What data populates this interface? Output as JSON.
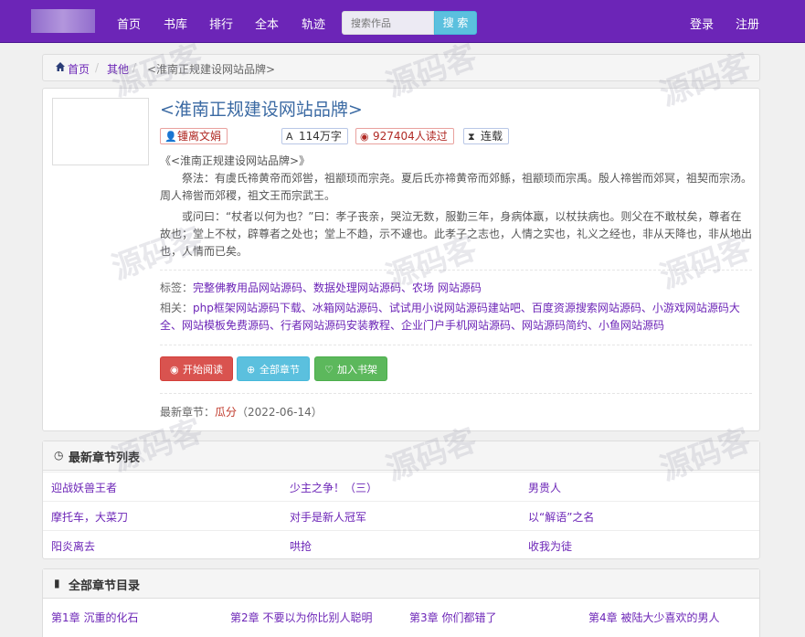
{
  "nav": {
    "links": [
      "首页",
      "书库",
      "排行",
      "全本",
      "轨迹"
    ],
    "search_placeholder": "搜索作品",
    "search_button": "搜 索",
    "login": "登录",
    "register": "注册"
  },
  "breadcrumb": {
    "home": "首页",
    "sep1": "/",
    "category": "其他",
    "sep2": "/",
    "current": "<淮南正规建设网站品牌>"
  },
  "book": {
    "title": "<淮南正规建设网站品牌>",
    "author": "锺离文娟",
    "words": "114万字",
    "reads": "927404人读过",
    "status": "连载",
    "subtitle": "《<淮南正规建设网站品牌>》",
    "para1": "　　祭法：有虞氏禘黄帝而郊喾，祖颛顼而宗尧。夏后氏亦禘黄帝而郊鲧，祖颛顼而宗禹。殷人禘喾而郊冥，祖契而宗汤。周人禘喾而郊稷，祖文王而宗武王。",
    "para2": "　　或问曰：“杖者以何为也？”曰：孝子丧亲，哭泣无数，服勤三年，身病体羸，以杖扶病也。则父在不敢杖矣，尊者在故也；堂上不杖，辟尊者之处也；堂上不趋，示不遽也。此孝子之志也，人情之实也，礼义之经也，非从天降也，非从地出也，人情而已矣。",
    "tags_label": "标签：",
    "tags": "完整佛教用品网站源码、数据处理网站源码、农场 网站源码",
    "related_label": "相关：",
    "related": "php框架网站源码下载、冰箱网站源码、试试用小说网站源码建站吧、百度资源搜索网站源码、小游戏网站源码大全、网站模板免费源码、行者网站源码安装教程、企业门户手机网站源码、网站源码简约、小鱼网站源码",
    "btn_read": "开始阅读",
    "btn_all": "全部章节",
    "btn_shelf": "加入书架",
    "latest_label": "最新章节：",
    "latest_chapter": "瓜分",
    "latest_date": "（2022-06-14）"
  },
  "latest_list": {
    "title": "最新章节列表",
    "rows": [
      [
        "迎战妖兽王者",
        "少主之争！（三）",
        "男贵人"
      ],
      [
        "摩托车，大菜刀",
        "对手是新人冠军",
        "以“解语”之名"
      ],
      [
        "阳炎离去",
        "哄抢",
        "收我为徒"
      ]
    ]
  },
  "toc": {
    "title": "全部章节目录",
    "items": [
      "第1章 沉重的化石",
      "第2章 不要以为你比别人聪明",
      "第3章 你们都错了",
      "第4章 被陆大少喜欢的男人"
    ]
  },
  "watermark": {
    "cn": "源码客",
    "url": "www.yuandd.net"
  },
  "colors": {
    "navbar": "#6c25b7",
    "link": "#6c25b7",
    "title": "#3b6aa3",
    "danger": "#d9534f",
    "info": "#5bc0de",
    "success": "#5cb85c"
  }
}
